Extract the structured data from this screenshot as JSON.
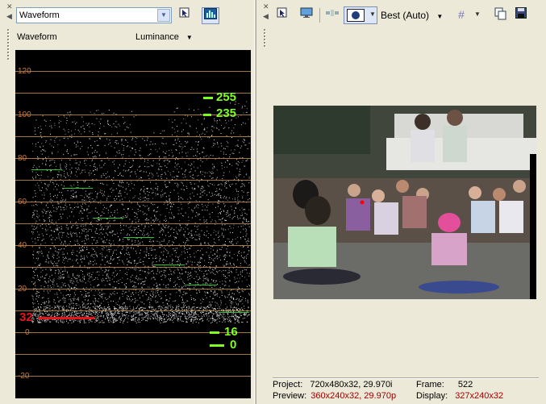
{
  "left_panel": {
    "scope_select_value": "Waveform",
    "scope_name": "Waveform",
    "channel": "Luminance",
    "y_axis_labels": [
      "120",
      "100",
      "80",
      "60",
      "40",
      "20",
      "0",
      "-20"
    ],
    "markers": {
      "white_255": "255",
      "white_235": "235",
      "black_16": "16",
      "black_0": "0",
      "setup_32": "32"
    },
    "icons": {
      "close": "close-icon",
      "collapse": "arrow-left-icon",
      "settings": "settings-icon",
      "monitor": "monitor-icon"
    }
  },
  "right_panel": {
    "quality": "Best (Auto)",
    "status": {
      "project_label": "Project:",
      "project_value": "720x480x32, 29.970i",
      "preview_label": "Preview:",
      "preview_value": "360x240x32, 29.970p",
      "frame_label": "Frame:",
      "frame_value": "522",
      "display_label": "Display:",
      "display_value": "327x240x32"
    }
  },
  "colors": {
    "graticule": "#c08a4a",
    "green_marker": "#7fff1f",
    "red_marker": "#e8141a",
    "status_red": "#a00000"
  }
}
